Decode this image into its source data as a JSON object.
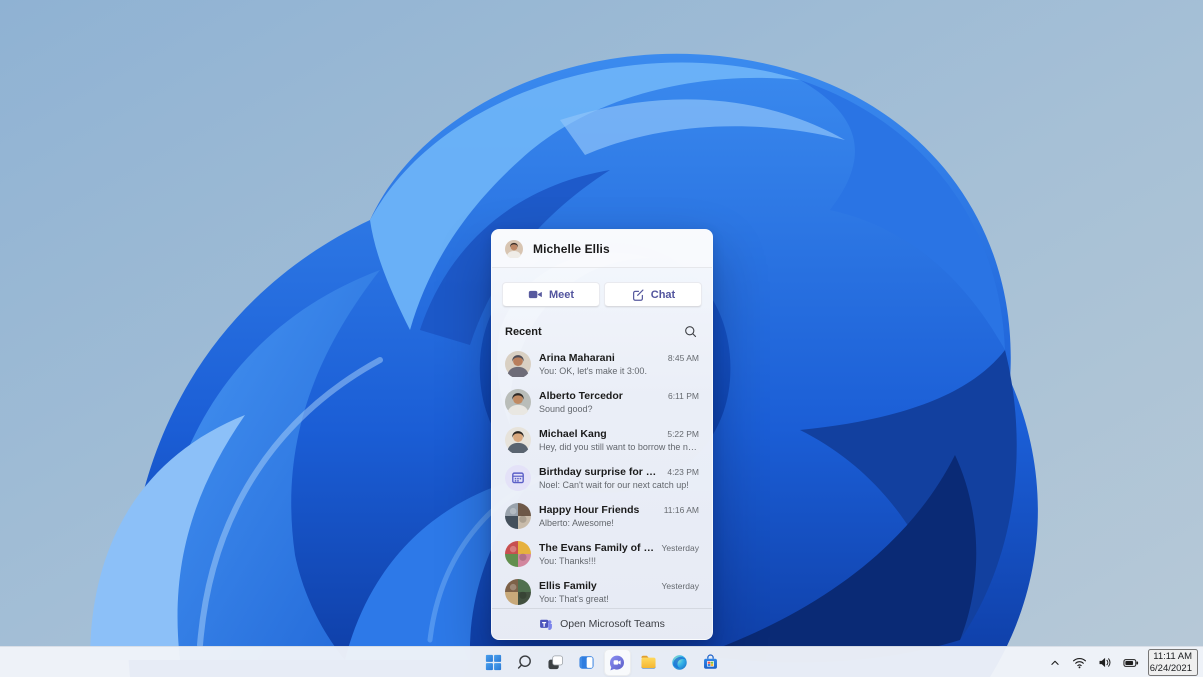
{
  "colors": {
    "windows_blue": "#2f7de0",
    "teams_purple": "#5b5fc7",
    "button_text_purple": "#52549e",
    "panel_bg": "#f4f5f9",
    "taskbar_bg": "#f0f4f9",
    "wallpaper_sky": "#9ab9d6",
    "wallpaper_bloom_dark": "#0a2a75",
    "wallpaper_bloom_light": "#5fa9f7"
  },
  "chat_flyout": {
    "header": {
      "user_name": "Michelle Ellis",
      "avatar": {
        "kind": "person",
        "bg": "#d8c5b2",
        "hair": "#3a2e28",
        "skin": "#bd8766",
        "shirt": "#efece7"
      }
    },
    "actions": {
      "meet_label": "Meet",
      "chat_label": "Chat"
    },
    "recent_label": "Recent",
    "conversations": [
      {
        "name": "Arina Maharani",
        "preview": "You: OK, let's make it 3:00.",
        "time": "8:45 AM",
        "avatar": {
          "kind": "person",
          "bg": "#d9d0c3",
          "hair": "#4e4c56",
          "skin": "#b97e5c",
          "shirt": "#6e6c78"
        }
      },
      {
        "name": "Alberto Tercedor",
        "preview": "Sound good?",
        "time": "6:11 PM",
        "avatar": {
          "kind": "person",
          "bg": "#b9bdb9",
          "hair": "#2f2a26",
          "skin": "#c08a62",
          "shirt": "#e9e7e2"
        }
      },
      {
        "name": "Michael Kang",
        "preview": "Hey, did you still want to borrow the notes?",
        "time": "5:22 PM",
        "avatar": {
          "kind": "person",
          "bg": "#e7e3db",
          "hair": "#2b2622",
          "skin": "#d9a87e",
          "shirt": "#5a6470"
        }
      },
      {
        "name": "Birthday surprise for Mum",
        "preview": "Noel: Can't wait for our next catch up!",
        "time": "4:23 PM",
        "avatar": {
          "kind": "calendar",
          "bg": "#e4e2f8",
          "glyph": "#5b5fc7"
        }
      },
      {
        "name": "Happy Hour Friends",
        "preview": "Alberto: Awesome!",
        "time": "11:16 AM",
        "avatar": {
          "kind": "group",
          "colors": [
            "#9aa3ad",
            "#6d5848",
            "#44505c",
            "#c9bcab"
          ]
        }
      },
      {
        "name": "The Evans Family of Supers",
        "preview": "You: Thanks!!!",
        "time": "Yesterday",
        "avatar": {
          "kind": "group",
          "colors": [
            "#c85050",
            "#e6b13e",
            "#628f4e",
            "#d2879e"
          ]
        }
      },
      {
        "name": "Ellis Family",
        "preview": "You: That's great!",
        "time": "Yesterday",
        "avatar": {
          "kind": "group",
          "colors": [
            "#7d6148",
            "#50704f",
            "#c8a97a",
            "#42503f"
          ]
        }
      }
    ],
    "footer": {
      "open_teams_label": "Open Microsoft Teams"
    }
  },
  "taskbar": {
    "items": [
      {
        "id": "start",
        "label": "Start",
        "active": false
      },
      {
        "id": "search",
        "label": "Search",
        "active": false
      },
      {
        "id": "task-view",
        "label": "Task View",
        "active": false
      },
      {
        "id": "widgets",
        "label": "Widgets",
        "active": false
      },
      {
        "id": "chat",
        "label": "Chat",
        "active": true
      },
      {
        "id": "file-explorer",
        "label": "File Explorer",
        "active": false
      },
      {
        "id": "edge",
        "label": "Microsoft Edge",
        "active": false
      },
      {
        "id": "microsoft-store",
        "label": "Microsoft Store",
        "active": false
      }
    ],
    "tray": {
      "time": "11:11 AM",
      "date": "6/24/2021"
    }
  }
}
